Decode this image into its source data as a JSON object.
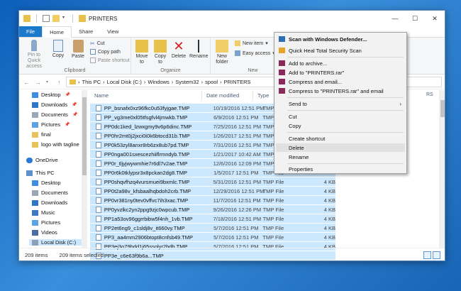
{
  "window": {
    "title": "PRINTERS",
    "controls": {
      "minimize": "—",
      "maximize": "☐",
      "close": "✕"
    }
  },
  "ribbon_tabs": [
    "File",
    "Home",
    "Share",
    "View"
  ],
  "ribbon": {
    "clipboard": {
      "pin": "Pin to Quick access",
      "copy": "Copy",
      "paste": "Paste",
      "cut": "Cut",
      "copy_path": "Copy path",
      "paste_shortcut": "Paste shortcut",
      "label": "Clipboard"
    },
    "organize": {
      "move_to": "Move to",
      "copy_to": "Copy to",
      "delete": "Delete",
      "rename": "Rename",
      "label": "Organize"
    },
    "new": {
      "new_folder": "New folder",
      "new_item": "New item",
      "easy_access": "Easy access",
      "label": "New"
    }
  },
  "address": {
    "crumbs": [
      "This PC",
      "Local Disk (C:)",
      "Windows",
      "System32",
      "spool",
      "PRINTERS"
    ],
    "search_placeholder": "RS"
  },
  "nav": {
    "items": [
      {
        "label": "Desktop",
        "pinned": true,
        "color": "#3b8ee0"
      },
      {
        "label": "Downloads",
        "pinned": true,
        "color": "#2f76c8"
      },
      {
        "label": "Documents",
        "pinned": true,
        "color": "#9aa7b8"
      },
      {
        "label": "Pictures",
        "pinned": true,
        "color": "#5ba4e5"
      },
      {
        "label": "final",
        "pinned": false,
        "color": "#e7c35a"
      },
      {
        "label": "logo with tagline",
        "pinned": false,
        "color": "#e7c35a"
      },
      {
        "label": "OneDrive",
        "pinned": false,
        "color": "#2b7bd6"
      },
      {
        "label": "This PC",
        "pinned": false,
        "color": "#5d8fc9"
      },
      {
        "label": "Desktop",
        "pinned": false,
        "color": "#3b8ee0"
      },
      {
        "label": "Documents",
        "pinned": false,
        "color": "#9aa7b8"
      },
      {
        "label": "Downloads",
        "pinned": false,
        "color": "#2f76c8"
      },
      {
        "label": "Music",
        "pinned": false,
        "color": "#3d79c4"
      },
      {
        "label": "Pictures",
        "pinned": false,
        "color": "#5ba4e5"
      },
      {
        "label": "Videos",
        "pinned": false,
        "color": "#4b6da6"
      },
      {
        "label": "Local Disk (C:)",
        "pinned": false,
        "color": "#8ea0b5"
      }
    ]
  },
  "columns": {
    "name": "Name",
    "date": "Date modified",
    "type": "Type"
  },
  "files": [
    {
      "name": "PP_bsnafx0xz96fkc0u53fyjgae.TMP",
      "date": "10/19/2016 12:51 PM",
      "type": "TMP File",
      "size": ""
    },
    {
      "name": "PP_vg3me0xl05tfsgfvl4jmwkb.TMP",
      "date": "6/9/2016 12:51 PM",
      "type": "TMP File",
      "size": ""
    },
    {
      "name": "PP0dc1ked_lzwxgmy9v6p6dinc.TMP",
      "date": "7/25/2016 12:51 PM",
      "type": "TMP File",
      "size": ""
    },
    {
      "name": "PP0hr2mt0j2jxci0i0k6btocd31b.TMP",
      "date": "1/26/2017 12:51 PM",
      "type": "TMP File",
      "size": ""
    },
    {
      "name": "PP0k53zyl8anxr8rb6zx8ub7pd.TMP",
      "date": "7/31/2016 12:51 PM",
      "type": "TMP File",
      "size": ""
    },
    {
      "name": "PP0nga001sxescezhiiflrmndyb.TMP",
      "date": "1/21/2017 10:42 AM",
      "type": "TMP File",
      "size": ""
    },
    {
      "name": "PP0r_tljyjwywmhie7r6dl7v2ae.TMP",
      "date": "12/6/2016 12:09 PM",
      "type": "TMP File",
      "size": ""
    },
    {
      "name": "PP0r6k0tklypsr3x8pckan2dg8.TMP",
      "date": "1/5/2017 12:51 PM",
      "type": "TMP File",
      "size": ""
    },
    {
      "name": "PP0shqvfhzq4vursmuei9bxmlc.TMP",
      "date": "5/31/2016 12:51 PM",
      "type": "TMP File",
      "size": "4 KB"
    },
    {
      "name": "PP0t2a98v_kfsbaalhqbdoh2crb.TMP",
      "date": "12/29/2016 12:51 PM",
      "type": "TMP File",
      "size": "4 KB"
    },
    {
      "name": "PP0vr381ny0tev0vffvc7ih3xac.TMP",
      "date": "11/7/2016 12:51 PM",
      "type": "TMP File",
      "size": "4 KB"
    },
    {
      "name": "PP0yvzlkc2yn2ppg9zjc0wpcub.TMP",
      "date": "9/26/2016 12:26 PM",
      "type": "TMP File",
      "size": "4 KB"
    },
    {
      "name": "PP1a53ov96ggrrbibw5f4nh_1vb.TMP",
      "date": "7/18/2016 12:51 PM",
      "type": "TMP File",
      "size": "4 KB"
    },
    {
      "name": "PP2et6ng9_c1sldj8v_it660vy.TMP",
      "date": "5/7/2016 12:51 PM",
      "type": "TMP File",
      "size": "4 KB"
    },
    {
      "name": "PP3_aa4mm2906btopt8cnfsb49.TMP",
      "date": "5/7/2016 12:51 PM",
      "type": "TMP File",
      "size": "4 KB"
    },
    {
      "name": "PP3ej3o79hdd1j65ssolyr2bdb.TMP",
      "date": "5/7/2016 12:51 PM",
      "type": "TMP File",
      "size": "4 KB"
    },
    {
      "name": "PP3e_c6e63f9b6a...TMP",
      "date": "",
      "type": "",
      "size": ""
    }
  ],
  "status": {
    "count": "209 items",
    "selected": "209 items selected"
  },
  "context_menu": {
    "defender": "Scan with Windows Defender...",
    "quickheal": "Quick Heal Total Security Scan",
    "add_archive": "Add to archive...",
    "add_rar": "Add to \"PRINTERS.rar\"",
    "compress_email": "Compress and email...",
    "compress_rar_email": "Compress to \"PRINTERS.rar\" and email",
    "send_to": "Send to",
    "cut": "Cut",
    "copy": "Copy",
    "create_shortcut": "Create shortcut",
    "delete": "Delete",
    "rename": "Rename",
    "properties": "Properties"
  }
}
